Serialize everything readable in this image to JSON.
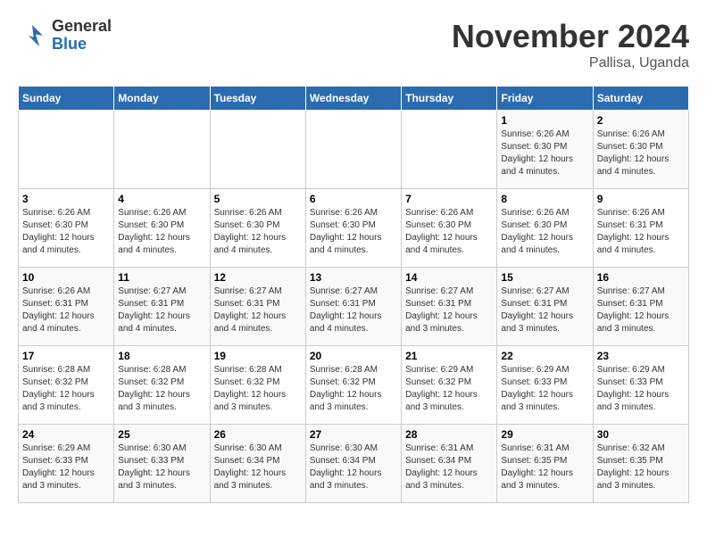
{
  "logo": {
    "general": "General",
    "blue": "Blue"
  },
  "title": {
    "month": "November 2024",
    "location": "Pallisa, Uganda"
  },
  "days_of_week": [
    "Sunday",
    "Monday",
    "Tuesday",
    "Wednesday",
    "Thursday",
    "Friday",
    "Saturday"
  ],
  "weeks": [
    [
      {
        "day": "",
        "info": ""
      },
      {
        "day": "",
        "info": ""
      },
      {
        "day": "",
        "info": ""
      },
      {
        "day": "",
        "info": ""
      },
      {
        "day": "",
        "info": ""
      },
      {
        "day": "1",
        "info": "Sunrise: 6:26 AM\nSunset: 6:30 PM\nDaylight: 12 hours and 4 minutes."
      },
      {
        "day": "2",
        "info": "Sunrise: 6:26 AM\nSunset: 6:30 PM\nDaylight: 12 hours and 4 minutes."
      }
    ],
    [
      {
        "day": "3",
        "info": "Sunrise: 6:26 AM\nSunset: 6:30 PM\nDaylight: 12 hours and 4 minutes."
      },
      {
        "day": "4",
        "info": "Sunrise: 6:26 AM\nSunset: 6:30 PM\nDaylight: 12 hours and 4 minutes."
      },
      {
        "day": "5",
        "info": "Sunrise: 6:26 AM\nSunset: 6:30 PM\nDaylight: 12 hours and 4 minutes."
      },
      {
        "day": "6",
        "info": "Sunrise: 6:26 AM\nSunset: 6:30 PM\nDaylight: 12 hours and 4 minutes."
      },
      {
        "day": "7",
        "info": "Sunrise: 6:26 AM\nSunset: 6:30 PM\nDaylight: 12 hours and 4 minutes."
      },
      {
        "day": "8",
        "info": "Sunrise: 6:26 AM\nSunset: 6:30 PM\nDaylight: 12 hours and 4 minutes."
      },
      {
        "day": "9",
        "info": "Sunrise: 6:26 AM\nSunset: 6:31 PM\nDaylight: 12 hours and 4 minutes."
      }
    ],
    [
      {
        "day": "10",
        "info": "Sunrise: 6:26 AM\nSunset: 6:31 PM\nDaylight: 12 hours and 4 minutes."
      },
      {
        "day": "11",
        "info": "Sunrise: 6:27 AM\nSunset: 6:31 PM\nDaylight: 12 hours and 4 minutes."
      },
      {
        "day": "12",
        "info": "Sunrise: 6:27 AM\nSunset: 6:31 PM\nDaylight: 12 hours and 4 minutes."
      },
      {
        "day": "13",
        "info": "Sunrise: 6:27 AM\nSunset: 6:31 PM\nDaylight: 12 hours and 4 minutes."
      },
      {
        "day": "14",
        "info": "Sunrise: 6:27 AM\nSunset: 6:31 PM\nDaylight: 12 hours and 3 minutes."
      },
      {
        "day": "15",
        "info": "Sunrise: 6:27 AM\nSunset: 6:31 PM\nDaylight: 12 hours and 3 minutes."
      },
      {
        "day": "16",
        "info": "Sunrise: 6:27 AM\nSunset: 6:31 PM\nDaylight: 12 hours and 3 minutes."
      }
    ],
    [
      {
        "day": "17",
        "info": "Sunrise: 6:28 AM\nSunset: 6:32 PM\nDaylight: 12 hours and 3 minutes."
      },
      {
        "day": "18",
        "info": "Sunrise: 6:28 AM\nSunset: 6:32 PM\nDaylight: 12 hours and 3 minutes."
      },
      {
        "day": "19",
        "info": "Sunrise: 6:28 AM\nSunset: 6:32 PM\nDaylight: 12 hours and 3 minutes."
      },
      {
        "day": "20",
        "info": "Sunrise: 6:28 AM\nSunset: 6:32 PM\nDaylight: 12 hours and 3 minutes."
      },
      {
        "day": "21",
        "info": "Sunrise: 6:29 AM\nSunset: 6:32 PM\nDaylight: 12 hours and 3 minutes."
      },
      {
        "day": "22",
        "info": "Sunrise: 6:29 AM\nSunset: 6:33 PM\nDaylight: 12 hours and 3 minutes."
      },
      {
        "day": "23",
        "info": "Sunrise: 6:29 AM\nSunset: 6:33 PM\nDaylight: 12 hours and 3 minutes."
      }
    ],
    [
      {
        "day": "24",
        "info": "Sunrise: 6:29 AM\nSunset: 6:33 PM\nDaylight: 12 hours and 3 minutes."
      },
      {
        "day": "25",
        "info": "Sunrise: 6:30 AM\nSunset: 6:33 PM\nDaylight: 12 hours and 3 minutes."
      },
      {
        "day": "26",
        "info": "Sunrise: 6:30 AM\nSunset: 6:34 PM\nDaylight: 12 hours and 3 minutes."
      },
      {
        "day": "27",
        "info": "Sunrise: 6:30 AM\nSunset: 6:34 PM\nDaylight: 12 hours and 3 minutes."
      },
      {
        "day": "28",
        "info": "Sunrise: 6:31 AM\nSunset: 6:34 PM\nDaylight: 12 hours and 3 minutes."
      },
      {
        "day": "29",
        "info": "Sunrise: 6:31 AM\nSunset: 6:35 PM\nDaylight: 12 hours and 3 minutes."
      },
      {
        "day": "30",
        "info": "Sunrise: 6:32 AM\nSunset: 6:35 PM\nDaylight: 12 hours and 3 minutes."
      }
    ]
  ]
}
